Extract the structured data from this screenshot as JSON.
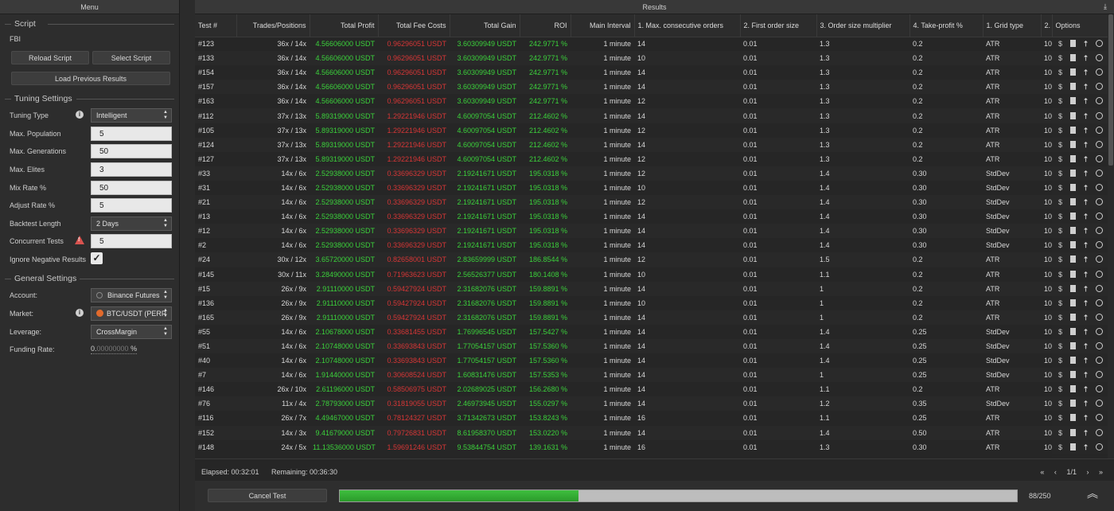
{
  "menu": {
    "title": "Menu",
    "script_section": "Script",
    "script_name": "FBI",
    "reload_label": "Reload Script",
    "select_label": "Select Script",
    "load_prev_label": "Load Previous Results",
    "tuning_section": "Tuning Settings",
    "tuning_type_label": "Tuning Type",
    "tuning_type_value": "Intelligent",
    "max_population_label": "Max. Population",
    "max_population_value": "5",
    "max_generations_label": "Max. Generations",
    "max_generations_value": "50",
    "max_elites_label": "Max. Elites",
    "max_elites_value": "3",
    "mix_rate_label": "Mix Rate %",
    "mix_rate_value": "50",
    "adjust_rate_label": "Adjust Rate %",
    "adjust_rate_value": "5",
    "backtest_length_label": "Backtest Length",
    "backtest_length_value": "2 Days",
    "concurrent_tests_label": "Concurrent Tests",
    "concurrent_tests_value": "5",
    "ignore_negative_label": "Ignore Negative Results",
    "general_section": "General Settings",
    "account_label": "Account:",
    "account_value": "Binance Futures",
    "market_label": "Market:",
    "market_value": "BTC/USDT (PERP",
    "leverage_label": "Leverage:",
    "leverage_value": "CrossMargin",
    "funding_rate_label": "Funding Rate:",
    "funding_rate_lead": "0.",
    "funding_rate_digits": "00000000",
    "funding_rate_unit": " %"
  },
  "results": {
    "title": "Results",
    "columns": [
      "Test #",
      "Trades/Positions",
      "Total Profit",
      "Total Fee Costs",
      "Total Gain",
      "ROI",
      "Main Interval",
      "1. Max. consecutive orders",
      "2. First order size",
      "3. Order size multiplier",
      "4. Take-profit %",
      "1. Grid type",
      "2.",
      "Options"
    ],
    "rows": [
      [
        "#123",
        "36x / 14x",
        "4.56606000 USDT",
        "0.96296051 USDT",
        "3.60309949 USDT",
        "242.9771 %",
        "1 minute",
        "14",
        "0.01",
        "1.3",
        "0.2",
        "ATR",
        "10"
      ],
      [
        "#133",
        "36x / 14x",
        "4.56606000 USDT",
        "0.96296051 USDT",
        "3.60309949 USDT",
        "242.9771 %",
        "1 minute",
        "10",
        "0.01",
        "1.3",
        "0.2",
        "ATR",
        "10"
      ],
      [
        "#154",
        "36x / 14x",
        "4.56606000 USDT",
        "0.96296051 USDT",
        "3.60309949 USDT",
        "242.9771 %",
        "1 minute",
        "14",
        "0.01",
        "1.3",
        "0.2",
        "ATR",
        "10"
      ],
      [
        "#157",
        "36x / 14x",
        "4.56606000 USDT",
        "0.96296051 USDT",
        "3.60309949 USDT",
        "242.9771 %",
        "1 minute",
        "14",
        "0.01",
        "1.3",
        "0.2",
        "ATR",
        "10"
      ],
      [
        "#163",
        "36x / 14x",
        "4.56606000 USDT",
        "0.96296051 USDT",
        "3.60309949 USDT",
        "242.9771 %",
        "1 minute",
        "12",
        "0.01",
        "1.3",
        "0.2",
        "ATR",
        "10"
      ],
      [
        "#112",
        "37x / 13x",
        "5.89319000 USDT",
        "1.29221946 USDT",
        "4.60097054 USDT",
        "212.4602 %",
        "1 minute",
        "14",
        "0.01",
        "1.3",
        "0.2",
        "ATR",
        "10"
      ],
      [
        "#105",
        "37x / 13x",
        "5.89319000 USDT",
        "1.29221946 USDT",
        "4.60097054 USDT",
        "212.4602 %",
        "1 minute",
        "12",
        "0.01",
        "1.3",
        "0.2",
        "ATR",
        "10"
      ],
      [
        "#124",
        "37x / 13x",
        "5.89319000 USDT",
        "1.29221946 USDT",
        "4.60097054 USDT",
        "212.4602 %",
        "1 minute",
        "14",
        "0.01",
        "1.3",
        "0.2",
        "ATR",
        "10"
      ],
      [
        "#127",
        "37x / 13x",
        "5.89319000 USDT",
        "1.29221946 USDT",
        "4.60097054 USDT",
        "212.4602 %",
        "1 minute",
        "12",
        "0.01",
        "1.3",
        "0.2",
        "ATR",
        "10"
      ],
      [
        "#33",
        "14x / 6x",
        "2.52938000 USDT",
        "0.33696329 USDT",
        "2.19241671 USDT",
        "195.0318 %",
        "1 minute",
        "12",
        "0.01",
        "1.4",
        "0.30",
        "StdDev",
        "10"
      ],
      [
        "#31",
        "14x / 6x",
        "2.52938000 USDT",
        "0.33696329 USDT",
        "2.19241671 USDT",
        "195.0318 %",
        "1 minute",
        "10",
        "0.01",
        "1.4",
        "0.30",
        "StdDev",
        "10"
      ],
      [
        "#21",
        "14x / 6x",
        "2.52938000 USDT",
        "0.33696329 USDT",
        "2.19241671 USDT",
        "195.0318 %",
        "1 minute",
        "12",
        "0.01",
        "1.4",
        "0.30",
        "StdDev",
        "10"
      ],
      [
        "#13",
        "14x / 6x",
        "2.52938000 USDT",
        "0.33696329 USDT",
        "2.19241671 USDT",
        "195.0318 %",
        "1 minute",
        "14",
        "0.01",
        "1.4",
        "0.30",
        "StdDev",
        "10"
      ],
      [
        "#12",
        "14x / 6x",
        "2.52938000 USDT",
        "0.33696329 USDT",
        "2.19241671 USDT",
        "195.0318 %",
        "1 minute",
        "14",
        "0.01",
        "1.4",
        "0.30",
        "StdDev",
        "10"
      ],
      [
        "#2",
        "14x / 6x",
        "2.52938000 USDT",
        "0.33696329 USDT",
        "2.19241671 USDT",
        "195.0318 %",
        "1 minute",
        "14",
        "0.01",
        "1.4",
        "0.30",
        "StdDev",
        "10"
      ],
      [
        "#24",
        "30x / 12x",
        "3.65720000 USDT",
        "0.82658001 USDT",
        "2.83659999 USDT",
        "186.8544 %",
        "1 minute",
        "12",
        "0.01",
        "1.5",
        "0.2",
        "ATR",
        "10"
      ],
      [
        "#145",
        "30x / 11x",
        "3.28490000 USDT",
        "0.71963623 USDT",
        "2.56526377 USDT",
        "180.1408 %",
        "1 minute",
        "10",
        "0.01",
        "1.1",
        "0.2",
        "ATR",
        "10"
      ],
      [
        "#15",
        "26x / 9x",
        "2.91110000 USDT",
        "0.59427924 USDT",
        "2.31682076 USDT",
        "159.8891 %",
        "1 minute",
        "14",
        "0.01",
        "1",
        "0.2",
        "ATR",
        "10"
      ],
      [
        "#136",
        "26x / 9x",
        "2.91110000 USDT",
        "0.59427924 USDT",
        "2.31682076 USDT",
        "159.8891 %",
        "1 minute",
        "10",
        "0.01",
        "1",
        "0.2",
        "ATR",
        "10"
      ],
      [
        "#165",
        "26x / 9x",
        "2.91110000 USDT",
        "0.59427924 USDT",
        "2.31682076 USDT",
        "159.8891 %",
        "1 minute",
        "14",
        "0.01",
        "1",
        "0.2",
        "ATR",
        "10"
      ],
      [
        "#55",
        "14x / 6x",
        "2.10678000 USDT",
        "0.33681455 USDT",
        "1.76996545 USDT",
        "157.5427 %",
        "1 minute",
        "14",
        "0.01",
        "1.4",
        "0.25",
        "StdDev",
        "10"
      ],
      [
        "#51",
        "14x / 6x",
        "2.10748000 USDT",
        "0.33693843 USDT",
        "1.77054157 USDT",
        "157.5360 %",
        "1 minute",
        "14",
        "0.01",
        "1.4",
        "0.25",
        "StdDev",
        "10"
      ],
      [
        "#40",
        "14x / 6x",
        "2.10748000 USDT",
        "0.33693843 USDT",
        "1.77054157 USDT",
        "157.5360 %",
        "1 minute",
        "14",
        "0.01",
        "1.4",
        "0.25",
        "StdDev",
        "10"
      ],
      [
        "#7",
        "14x / 6x",
        "1.91440000 USDT",
        "0.30608524 USDT",
        "1.60831476 USDT",
        "157.5353 %",
        "1 minute",
        "14",
        "0.01",
        "1",
        "0.25",
        "StdDev",
        "10"
      ],
      [
        "#146",
        "26x / 10x",
        "2.61196000 USDT",
        "0.58506975 USDT",
        "2.02689025 USDT",
        "156.2680 %",
        "1 minute",
        "14",
        "0.01",
        "1.1",
        "0.2",
        "ATR",
        "10"
      ],
      [
        "#76",
        "11x / 4x",
        "2.78793000 USDT",
        "0.31819055 USDT",
        "2.46973945 USDT",
        "155.0297 %",
        "1 minute",
        "14",
        "0.01",
        "1.2",
        "0.35",
        "StdDev",
        "10"
      ],
      [
        "#116",
        "26x / 7x",
        "4.49467000 USDT",
        "0.78124327 USDT",
        "3.71342673 USDT",
        "153.8243 %",
        "1 minute",
        "16",
        "0.01",
        "1.1",
        "0.25",
        "ATR",
        "10"
      ],
      [
        "#152",
        "14x / 3x",
        "9.41679000 USDT",
        "0.79726831 USDT",
        "8.61958370 USDT",
        "153.0220 %",
        "1 minute",
        "14",
        "0.01",
        "1.4",
        "0.50",
        "ATR",
        "10"
      ],
      [
        "#148",
        "24x / 5x",
        "11.13536000 USDT",
        "1.59691246 USDT",
        "9.53844754 USDT",
        "139.1631 %",
        "1 minute",
        "16",
        "0.01",
        "1.3",
        "0.30",
        "ATR",
        "10"
      ]
    ],
    "elapsed": "Elapsed: 00:32:01",
    "remaining": "Remaining: 00:36:30",
    "page_prev": "«",
    "page_back": "‹",
    "page_indicator": "1/1",
    "page_next": "›",
    "page_last": "»",
    "cancel_label": "Cancel Test",
    "progress_done": 88,
    "progress_total": 250,
    "progress_text": "88/250"
  },
  "colors": {
    "profit": "#3bd13b",
    "fee": "#d63636",
    "progress": "#3fbf3f"
  },
  "icons": [
    "dollar-icon",
    "document-icon",
    "export-icon",
    "user-icon",
    "info-icon",
    "warning-icon",
    "checkmark-icon",
    "download-icon",
    "chevron-up-icon"
  ]
}
